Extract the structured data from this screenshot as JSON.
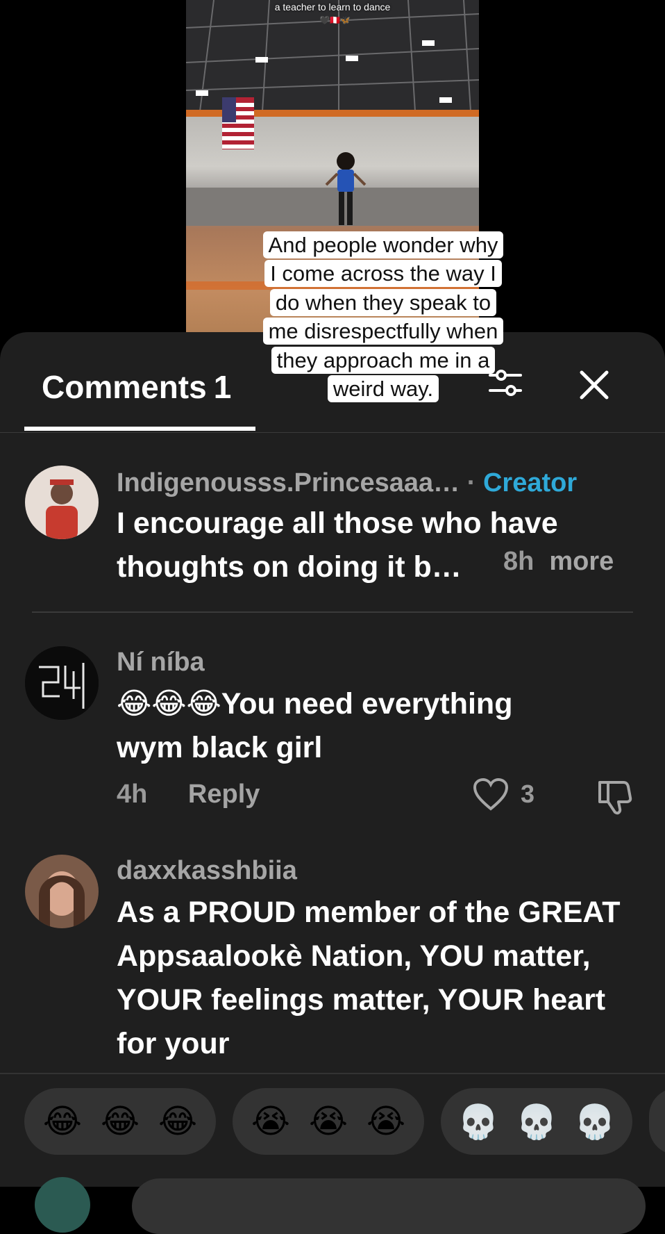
{
  "video": {
    "caption_line": "a teacher to learn to dance",
    "caption_emojis": "🖤🇵🇪🦋"
  },
  "overlay_text": "And people wonder why I come across the way I do when they speak to me disrespectfully when they approach me in a weird way.",
  "comments_header": {
    "title": "Comments",
    "count": "1"
  },
  "comments": [
    {
      "username": "Indigenousss.Princesaaa…",
      "separator": " · ",
      "badge": "Creator",
      "text": "I encourage all those who have thoughts on doing it b…",
      "time": "8h",
      "more": "more"
    },
    {
      "username": "Ní níba",
      "text_line1": "😂😂😂You need everything",
      "text_line2": "wym black girl",
      "time": "4h",
      "reply": "Reply",
      "likes": "3"
    },
    {
      "username": "daxxkasshbiia",
      "text": "As a PROUD member of the GREAT Appsaalookè Nation, YOU matter, YOUR feelings matter, YOUR heart for your"
    }
  ],
  "reactions": [
    {
      "emojis": [
        "😂",
        "😂",
        "😂"
      ]
    },
    {
      "emojis": [
        "😭",
        "😭",
        "😭"
      ]
    },
    {
      "emojis": [
        "💀",
        "💀",
        "💀"
      ]
    }
  ],
  "colors": {
    "sheet_bg": "#1f1f1f",
    "creator_badge": "#2fa9d8",
    "pill_bg": "#333333"
  }
}
